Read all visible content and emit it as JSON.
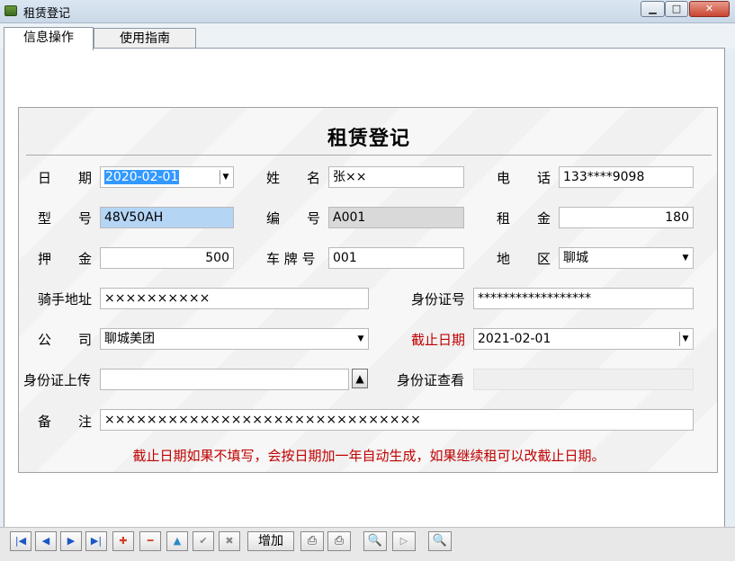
{
  "window": {
    "title": "租赁登记"
  },
  "tabs": [
    {
      "label": "信息操作"
    },
    {
      "label": "使用指南"
    }
  ],
  "form": {
    "heading": "租赁登记",
    "date": {
      "label": "日　　期",
      "value": "2020-02-01"
    },
    "name": {
      "label": "姓　　名",
      "value": "张××"
    },
    "phone": {
      "label": "电　　话",
      "value": "133****9098"
    },
    "model": {
      "label": "型　　号",
      "value": "48V50AH"
    },
    "code": {
      "label": "编　　号",
      "value": "A001"
    },
    "rent": {
      "label": "租　　金",
      "value": "180"
    },
    "deposit": {
      "label": "押　　金",
      "value": "500"
    },
    "plate": {
      "label": "车 牌 号",
      "value": "001"
    },
    "region": {
      "label": "地　　区",
      "value": "聊城"
    },
    "rider_address": {
      "label": "骑手地址",
      "value": "××××××××××"
    },
    "id_number": {
      "label": "身份证号",
      "value": "******************"
    },
    "company": {
      "label": "公　　司",
      "value": "聊城美团"
    },
    "end_date": {
      "label": "截止日期",
      "value": "2021-02-01"
    },
    "id_upload": {
      "label": "身份证上传",
      "value": ""
    },
    "id_view": {
      "label": "身份证查看"
    },
    "remark": {
      "label": "备　　注",
      "value": "××××××××××××××××××××××××××××××"
    },
    "notice": "截止日期如果不填写，会按日期加一年自动生成，如果继续租可以改截止日期。"
  },
  "toolbar": {
    "add_label": "增加"
  },
  "colors": {
    "selection": "#3399ff",
    "highlight_field": "#b5d5f5",
    "readonly_field": "#d9d9d9",
    "warning_text": "#c00000"
  }
}
